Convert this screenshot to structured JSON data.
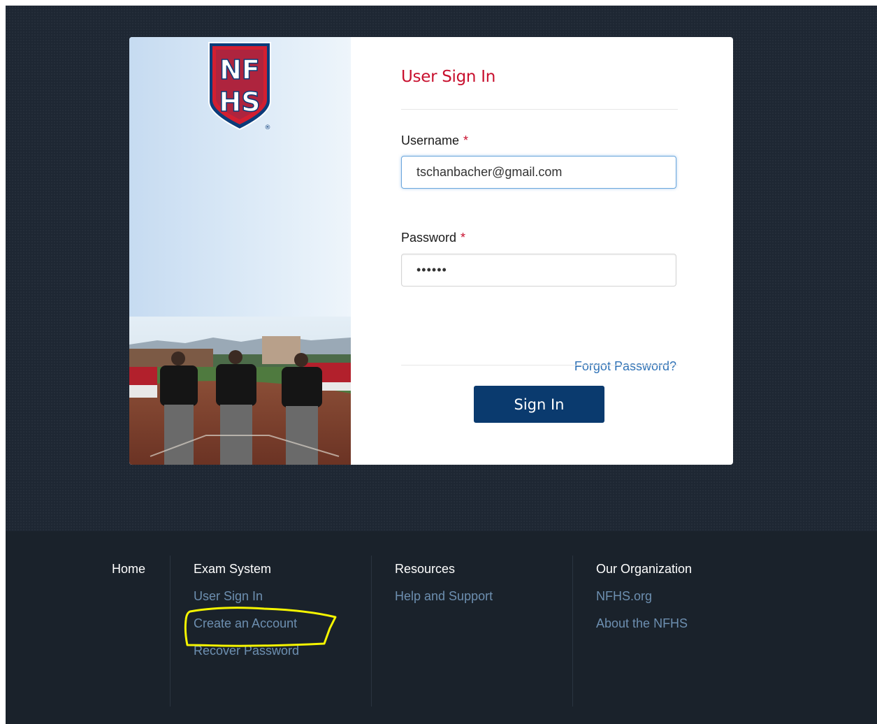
{
  "signin": {
    "title": "User Sign In",
    "username_label": "Username",
    "required_marker": "*",
    "username_value": "tschanbacher@gmail.com",
    "password_label": "Password",
    "password_mask": "••••••",
    "forgot_label": "Forgot Password?",
    "submit_label": "Sign In"
  },
  "brand": {
    "logo_text_top": "NF",
    "logo_text_bottom": "HS",
    "logo_mark": "®",
    "logo_icon": "nfhs-shield-logo",
    "photo_icon": "baseball-umpires-photo",
    "accent_color": "#c8102e",
    "link_color": "#2f72b6",
    "button_color": "#0a3a6e"
  },
  "footer": {
    "home_label": "Home",
    "exam": {
      "heading": "Exam System",
      "links": [
        "User Sign In",
        "Create an Account",
        "Recover Password"
      ]
    },
    "resources": {
      "heading": "Resources",
      "links": [
        "Help and Support"
      ]
    },
    "organization": {
      "heading": "Our Organization",
      "links": [
        "NFHS.org",
        "About the NFHS"
      ]
    }
  }
}
